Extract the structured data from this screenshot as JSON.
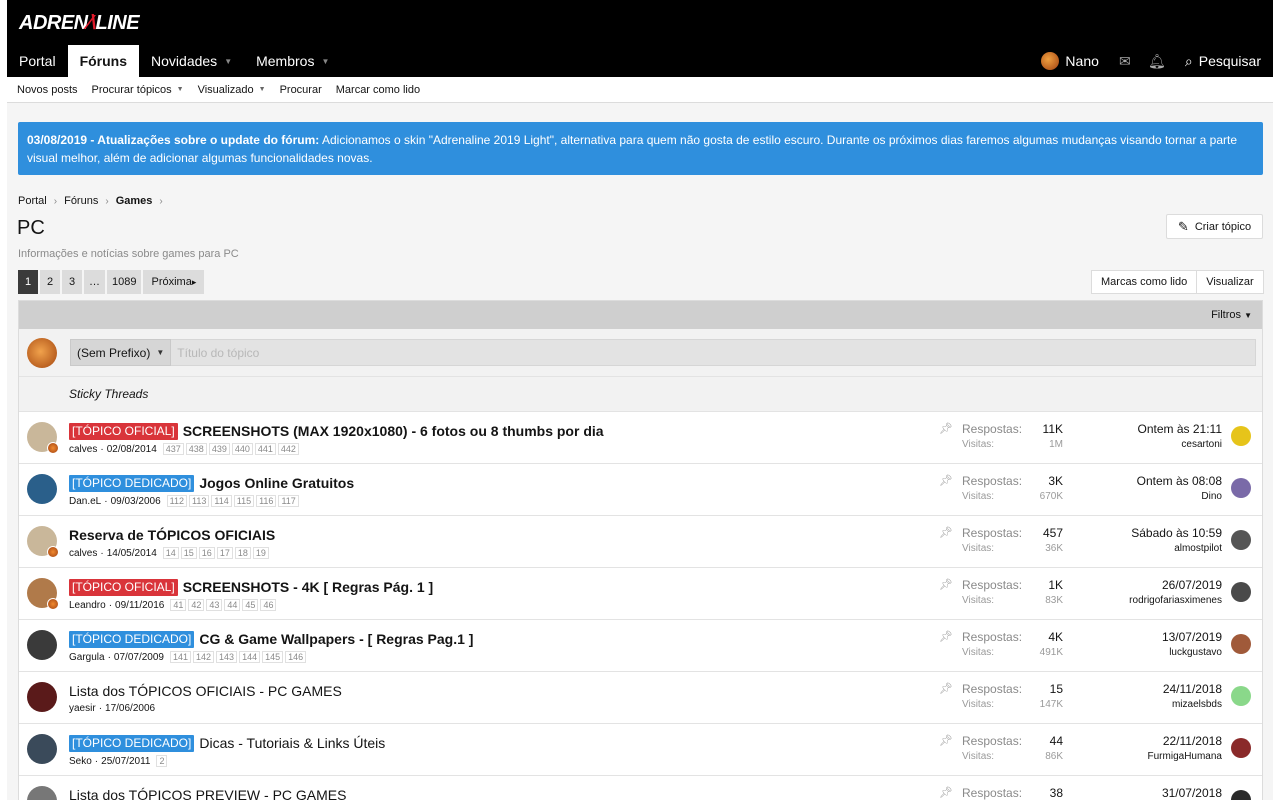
{
  "header": {
    "logo_left": "ADREN",
    "logo_right": "LINE",
    "nav": [
      {
        "label": "Portal",
        "active": false,
        "caret": false
      },
      {
        "label": "Fóruns",
        "active": true,
        "caret": false
      },
      {
        "label": "Novidades",
        "active": false,
        "caret": true
      },
      {
        "label": "Membros",
        "active": false,
        "caret": true
      }
    ],
    "user_name": "Nano",
    "search_label": "Pesquisar"
  },
  "subnav": {
    "items": [
      {
        "label": "Novos posts"
      },
      {
        "label": "Procurar tópicos"
      },
      {
        "label": "Visualizado"
      },
      {
        "label": "Procurar"
      },
      {
        "label": "Marcar como lido"
      }
    ]
  },
  "notice": {
    "bold": "03/08/2019 - Atualizações sobre o update do fórum:",
    "text": " Adicionamos o skin \"Adrenaline 2019 Light\", alternativa para quem não gosta de estilo escuro. Durante os próximos dias faremos algumas mudanças visando tornar a parte visual melhor, além de adicionar algumas funcionalidades novas."
  },
  "breadcrumb": [
    "Portal",
    "Fóruns",
    "Games"
  ],
  "page_title": "PC",
  "page_desc": "Informações e notícias sobre games para PC",
  "create_button": "Criar tópico",
  "pagination": {
    "pages": [
      "1",
      "2",
      "3",
      "…",
      "1089"
    ],
    "next_label": "Próxima"
  },
  "toolbar": {
    "mark_read": "Marcas como lido",
    "view": "Visualizar"
  },
  "filters_label": "Filtros",
  "quick_thread": {
    "prefix": "(Sem Prefixo)",
    "placeholder": "Título do tópico"
  },
  "sticky_header": "Sticky Threads",
  "stat_labels": {
    "replies": "Respostas:",
    "views": "Visitas:"
  },
  "threads": [
    {
      "tag": "[TÓPICO OFICIAL]",
      "tag_color": "red",
      "title": "SCREENSHOTS (MAX 1920x1080) - 6 fotos ou 8 thumbs por dia",
      "bold": true,
      "author": "calves",
      "date": "02/08/2014",
      "pages": [
        "437",
        "438",
        "439",
        "440",
        "441",
        "442"
      ],
      "replies": "11K",
      "views": "1M",
      "last_date": "Ontem às 21:11",
      "last_user": "cesartoni",
      "av": "#c9b79a",
      "lav": "#e6c41a"
    },
    {
      "tag": "[TÓPICO DEDICADO]",
      "tag_color": "blue",
      "title": "Jogos Online Gratuitos",
      "bold": true,
      "author": "Dan.eL",
      "date": "09/03/2006",
      "pages": [
        "112",
        "113",
        "114",
        "115",
        "116",
        "117"
      ],
      "replies": "3K",
      "views": "670K",
      "last_date": "Ontem às 08:08",
      "last_user": "Dino",
      "av": "#2a5f8a",
      "lav": "#7a6aa8"
    },
    {
      "tag": "",
      "tag_color": "",
      "title": "Reserva de TÓPICOS OFICIAIS",
      "bold": true,
      "author": "calves",
      "date": "14/05/2014",
      "pages": [
        "14",
        "15",
        "16",
        "17",
        "18",
        "19"
      ],
      "replies": "457",
      "views": "36K",
      "last_date": "Sábado às 10:59",
      "last_user": "almostpilot",
      "av": "#c9b79a",
      "lav": "#555555"
    },
    {
      "tag": "[TÓPICO OFICIAL]",
      "tag_color": "red",
      "title": "SCREENSHOTS - 4K [ Regras Pág. 1 ]",
      "bold": true,
      "author": "Leandro",
      "date": "09/11/2016",
      "pages": [
        "41",
        "42",
        "43",
        "44",
        "45",
        "46"
      ],
      "replies": "1K",
      "views": "83K",
      "last_date": "26/07/2019",
      "last_user": "rodrigofariasximenes",
      "av": "#b07a4a",
      "lav": "#4a4a4a"
    },
    {
      "tag": "[TÓPICO DEDICADO]",
      "tag_color": "blue",
      "title": "CG & Game Wallpapers - [ Regras Pag.1 ]",
      "bold": true,
      "author": "Gargula",
      "date": "07/07/2009",
      "pages": [
        "141",
        "142",
        "143",
        "144",
        "145",
        "146"
      ],
      "replies": "4K",
      "views": "491K",
      "last_date": "13/07/2019",
      "last_user": "luckgustavo",
      "av": "#3a3a3a",
      "lav": "#a05a3a"
    },
    {
      "tag": "",
      "tag_color": "",
      "title": "Lista dos TÓPICOS OFICIAIS - PC GAMES",
      "bold": false,
      "author": "yaesir",
      "date": "17/06/2006",
      "pages": [],
      "replies": "15",
      "views": "147K",
      "last_date": "24/11/2018",
      "last_user": "mizaelsbds",
      "av": "#5a1a1a",
      "lav": "#8ad88a"
    },
    {
      "tag": "[TÓPICO DEDICADO]",
      "tag_color": "blue",
      "title": "Dicas - Tutoriais & Links Úteis",
      "bold": false,
      "author": "Seko",
      "date": "25/07/2011",
      "pages": [
        "2"
      ],
      "replies": "44",
      "views": "86K",
      "last_date": "22/11/2018",
      "last_user": "FurmigaHumana",
      "av": "#3a4a5a",
      "lav": "#8a2a2a"
    },
    {
      "tag": "",
      "tag_color": "",
      "title": "Lista dos TÓPICOS PREVIEW - PC GAMES",
      "bold": false,
      "author": "",
      "date": "",
      "pages": [],
      "replies": "38",
      "views": "",
      "last_date": "31/07/2018",
      "last_user": "",
      "av": "#777777",
      "lav": "#2a2a2a"
    }
  ]
}
